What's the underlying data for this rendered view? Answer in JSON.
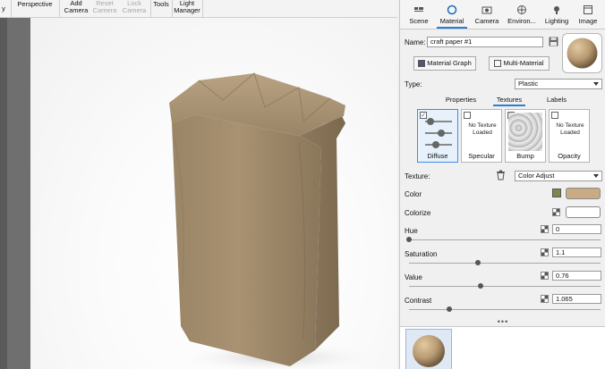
{
  "toolbar": {
    "items": [
      {
        "label": "y",
        "enabled": true
      },
      {
        "label": "Perspective",
        "enabled": true
      },
      {
        "label": "Add Camera",
        "enabled": true
      },
      {
        "label": "Reset Camera",
        "enabled": false
      },
      {
        "label": "Lock Camera",
        "enabled": false
      },
      {
        "label": "Tools",
        "enabled": true
      },
      {
        "label": "Light Manager",
        "enabled": true
      }
    ]
  },
  "panel_tabs": [
    {
      "label": "Scene",
      "icon": "scene-icon"
    },
    {
      "label": "Material",
      "icon": "material-icon",
      "active": true
    },
    {
      "label": "Camera",
      "icon": "camera-icon"
    },
    {
      "label": "Environ...",
      "icon": "environment-icon"
    },
    {
      "label": "Lighting",
      "icon": "lighting-icon"
    },
    {
      "label": "Image",
      "icon": "image-icon"
    }
  ],
  "material": {
    "name_label": "Name:",
    "name_value": "craft paper #1",
    "material_graph_label": "Material Graph",
    "multi_material_label": "Multi-Material",
    "type_label": "Type:",
    "type_value": "Plastic"
  },
  "sub_tabs": [
    {
      "label": "Properties"
    },
    {
      "label": "Textures",
      "active": true
    },
    {
      "label": "Labels"
    }
  ],
  "textures": [
    {
      "caption": "Diffuse",
      "checked": true,
      "loaded": true
    },
    {
      "caption": "Specular",
      "checked": false,
      "loaded": false,
      "empty_text": "No Texture Loaded"
    },
    {
      "caption": "Bump",
      "checked": true,
      "loaded": true
    },
    {
      "caption": "Opacity",
      "checked": false,
      "loaded": false,
      "empty_text": "No Texture Loaded"
    }
  ],
  "texture_row": {
    "label": "Texture:",
    "value": "Color Adjust"
  },
  "params": {
    "color_label": "Color",
    "color_value": "#c8ab84",
    "colorize_label": "Colorize",
    "colorize_value": "#ffffff",
    "hue_label": "Hue",
    "hue_value": "0",
    "saturation_label": "Saturation",
    "saturation_value": "1.1",
    "value_label": "Value",
    "value_value": "0.76",
    "contrast_label": "Contrast",
    "contrast_value": "1.065"
  },
  "more_indicator": "•••"
}
